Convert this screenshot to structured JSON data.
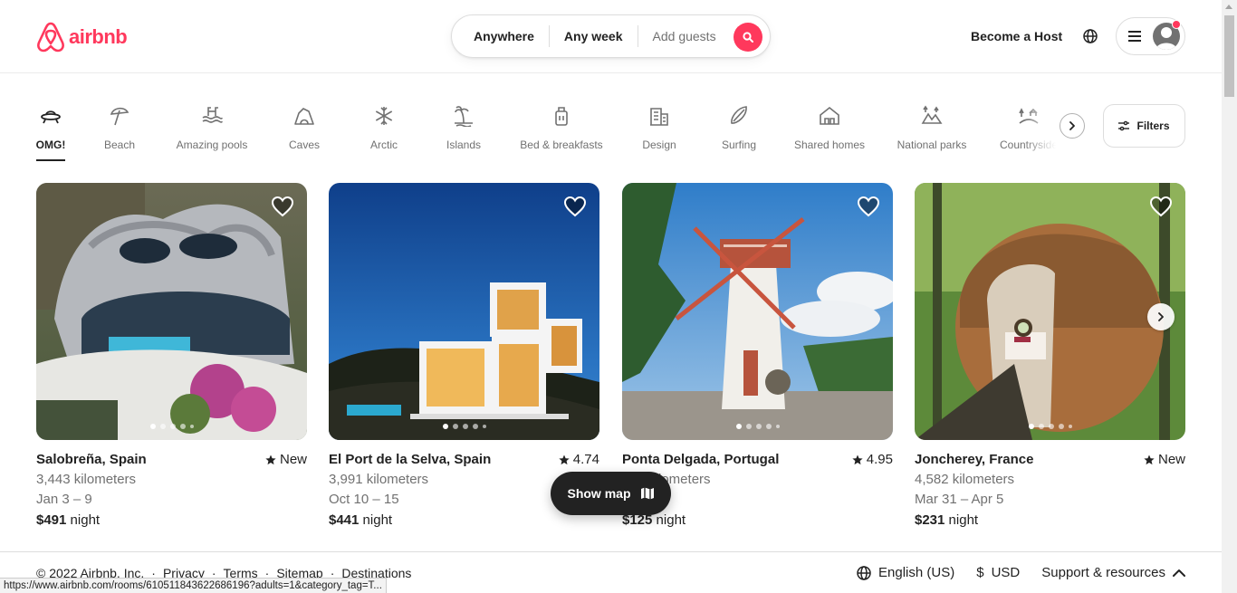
{
  "brand": {
    "name": "airbnb",
    "color": "#FF385C"
  },
  "search": {
    "where": "Anywhere",
    "when": "Any week",
    "guests": "Add guests"
  },
  "header": {
    "host_link": "Become a Host"
  },
  "categories": [
    {
      "label": "OMG!",
      "icon": "ufo-icon",
      "active": true
    },
    {
      "label": "Beach",
      "icon": "beach-umbrella-icon"
    },
    {
      "label": "Amazing pools",
      "icon": "pool-icon"
    },
    {
      "label": "Caves",
      "icon": "cave-icon"
    },
    {
      "label": "Arctic",
      "icon": "snowflake-icon"
    },
    {
      "label": "Islands",
      "icon": "island-icon"
    },
    {
      "label": "Bed & breakfasts",
      "icon": "coffee-icon"
    },
    {
      "label": "Design",
      "icon": "design-building-icon"
    },
    {
      "label": "Surfing",
      "icon": "surfboard-icon"
    },
    {
      "label": "Shared homes",
      "icon": "shared-home-icon"
    },
    {
      "label": "National parks",
      "icon": "national-park-icon"
    },
    {
      "label": "Countryside",
      "icon": "countryside-icon"
    }
  ],
  "filters_label": "Filters",
  "listings": [
    {
      "location": "Salobreña, Spain",
      "rating": "New",
      "distance": "3,443 kilometers",
      "dates": "Jan 3 – 9",
      "price": "$491",
      "price_unit": "night"
    },
    {
      "location": "El Port de la Selva, Spain",
      "rating": "4.74",
      "distance": "3,991 kilometers",
      "dates": "Oct 10 – 15",
      "price": "$441",
      "price_unit": "night"
    },
    {
      "location": "Ponta Delgada, Portugal",
      "rating": "4.95",
      "distance": "3,... kilometers",
      "dates": "... 27",
      "price": "$125",
      "price_unit": "night"
    },
    {
      "location": "Joncherey, France",
      "rating": "New",
      "distance": "4,582 kilometers",
      "dates": "Mar 31 – Apr 5",
      "price": "$231",
      "price_unit": "night"
    }
  ],
  "show_map_label": "Show map",
  "footer": {
    "copyright": "© 2022 Airbnb, Inc.",
    "links": [
      "Privacy",
      "Terms",
      "Sitemap",
      "Destinations"
    ],
    "language": "English (US)",
    "currency_symbol": "$",
    "currency": "USD",
    "support": "Support & resources"
  },
  "status_url": "https://www.airbnb.com/rooms/610511843622686196?adults=1&category_tag=T..."
}
